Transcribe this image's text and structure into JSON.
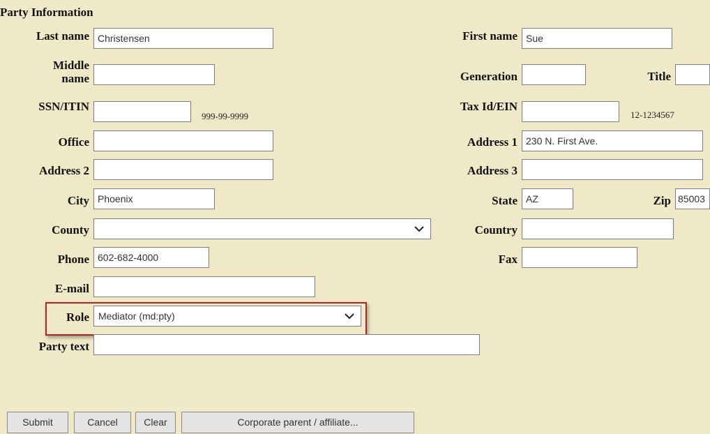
{
  "section_title": "Party Information",
  "fields": {
    "last_name": {
      "label": "Last name",
      "value": "Christensen"
    },
    "first_name": {
      "label": "First name",
      "value": "Sue"
    },
    "middle_name": {
      "label": "Middle name",
      "value": ""
    },
    "generation": {
      "label": "Generation",
      "value": ""
    },
    "title": {
      "label": "Title",
      "value": ""
    },
    "ssn": {
      "label": "SSN/ITIN",
      "value": "",
      "hint": "999-99-9999"
    },
    "tax_id": {
      "label": "Tax Id/EIN",
      "value": "",
      "hint": "12-1234567"
    },
    "office": {
      "label": "Office",
      "value": ""
    },
    "address1": {
      "label": "Address 1",
      "value": "230 N. First Ave."
    },
    "address2": {
      "label": "Address 2",
      "value": ""
    },
    "address3": {
      "label": "Address 3",
      "value": ""
    },
    "city": {
      "label": "City",
      "value": "Phoenix"
    },
    "state": {
      "label": "State",
      "value": "AZ"
    },
    "zip": {
      "label": "Zip",
      "value": "85003"
    },
    "county": {
      "label": "County",
      "value": ""
    },
    "country": {
      "label": "Country",
      "value": ""
    },
    "phone": {
      "label": "Phone",
      "value": "602-682-4000"
    },
    "fax": {
      "label": "Fax",
      "value": ""
    },
    "email": {
      "label": "E-mail",
      "value": ""
    },
    "role": {
      "label": "Role",
      "value": "Mediator (md:pty)"
    },
    "party_text": {
      "label": "Party text",
      "value": ""
    }
  },
  "buttons": {
    "submit": "Submit",
    "cancel": "Cancel",
    "clear": "Clear",
    "corporate": "Corporate parent / affiliate..."
  },
  "colors": {
    "background": "#efe9c8",
    "highlight": "#b22222"
  }
}
